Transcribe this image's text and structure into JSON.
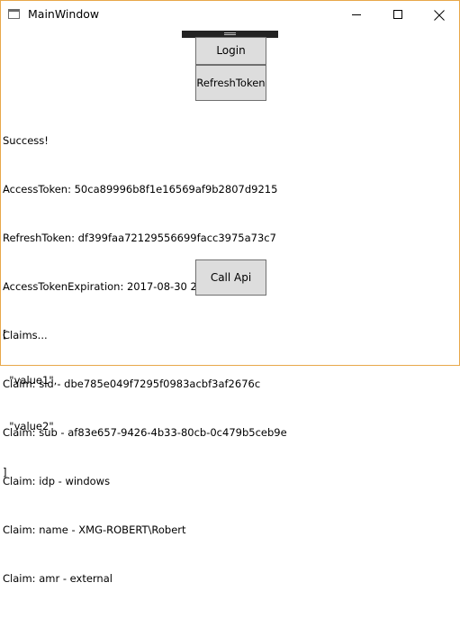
{
  "window": {
    "title": "MainWindow",
    "border_color": "#e8a84a"
  },
  "titlebar": {
    "app_icon": "window-icon",
    "minimize_icon": "minimize-icon",
    "maximize_icon": "maximize-icon",
    "close_icon": "close-icon"
  },
  "buttons": {
    "login_label": "Login",
    "refresh_label": "RefreshToken",
    "call_api_label": "Call Api"
  },
  "output": {
    "lines": [
      "Success!",
      "AccessToken: 50ca89996b8f1e16569af9b2807d9215",
      "RefreshToken: df399faa72129556699facc3975a73c7",
      "AccessTokenExpiration: 2017-08-30 23:21:26",
      "Claims...",
      "Claim: sid - dbe785e049f7295f0983acbf3af2676c",
      "Claim: sub - af83e657-9426-4b33-80cb-0c479b5ceb9e",
      "Claim: idp - windows",
      "Claim: name - XMG-ROBERT\\Robert",
      "Claim: amr - external"
    ]
  },
  "api_output": {
    "lines": [
      "[",
      "  \"value1\",",
      "  \"value2\"",
      "]"
    ]
  }
}
